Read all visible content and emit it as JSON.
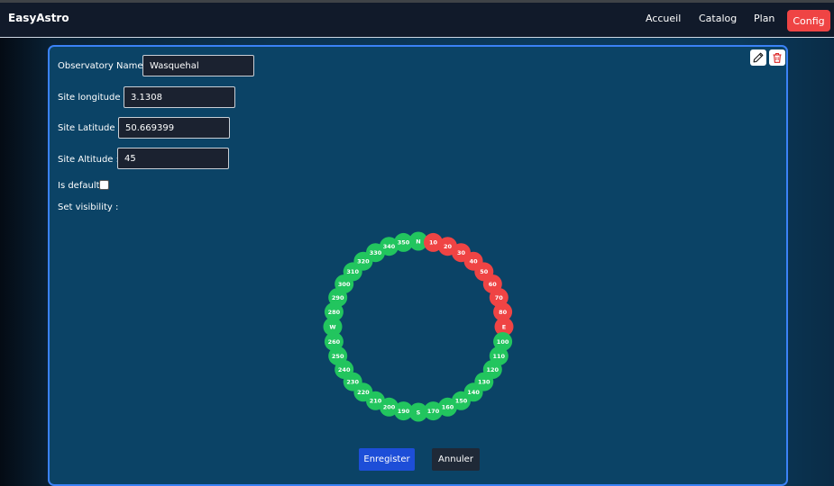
{
  "navbar": {
    "brand": "EasyAstro",
    "links": [
      "Accueil",
      "Catalog",
      "Plan"
    ],
    "active_link": "Config"
  },
  "form": {
    "observatory_name_label": "Observatory Name :",
    "observatory_name_value": "Wasquehal",
    "longitude_label": "Site longitude :",
    "longitude_value": "3.1308",
    "latitude_label": "Site Latitude :",
    "latitude_value": "50.669399",
    "altitude_label": "Site Altitude :",
    "altitude_value": "45",
    "is_default_label": "Is default :",
    "is_default_checked": false,
    "visibility_label": "Set visibility :"
  },
  "actions": {
    "save_label": "Enregister",
    "cancel_label": "Annuler"
  },
  "icons": {
    "edit": "pencil-icon",
    "delete": "trash-icon"
  },
  "colors": {
    "visible": "#22c55e",
    "hidden": "#ef4444",
    "accent": "#3b82f6",
    "config_button": "#ef4444",
    "save_button": "#1d4ed8"
  },
  "visibility": {
    "labels": [
      "N",
      "10",
      "20",
      "30",
      "40",
      "50",
      "60",
      "70",
      "80",
      "E",
      "100",
      "110",
      "120",
      "130",
      "140",
      "150",
      "160",
      "170",
      "S",
      "190",
      "200",
      "210",
      "220",
      "230",
      "240",
      "250",
      "260",
      "W",
      "280",
      "290",
      "300",
      "310",
      "320",
      "330",
      "340",
      "350"
    ],
    "hidden_azimuths": [
      "10",
      "20",
      "30",
      "40",
      "50",
      "60",
      "70",
      "80",
      "E"
    ]
  }
}
